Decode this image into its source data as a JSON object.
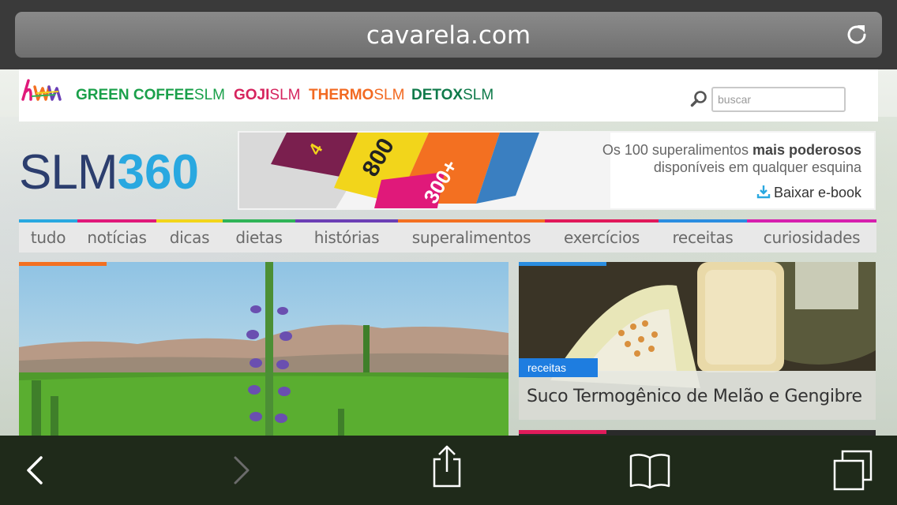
{
  "browser": {
    "url": "cavarela.com",
    "reload_icon": "reload-icon",
    "toolbar": {
      "back_icon": "chevron-left-icon",
      "forward_icon": "chevron-right-icon",
      "share_icon": "share-icon",
      "bookmarks_icon": "book-icon",
      "tabs_icon": "tabs-icon"
    }
  },
  "brandbar": {
    "logo_text": "hw",
    "brands": [
      {
        "bold": "GREEN COFFEE",
        "slm": "SLM",
        "color": "#1aa04a"
      },
      {
        "bold": "GOJI",
        "slm": "SLM",
        "color": "#d6245e"
      },
      {
        "bold": "THERMO",
        "slm": "SLM",
        "color": "#f26a22"
      },
      {
        "bold": "DETOX",
        "slm": "SLM",
        "color": "#0f7a4a"
      }
    ],
    "search_placeholder": "buscar"
  },
  "site": {
    "logo_slm": "SLM",
    "logo_num": "360"
  },
  "banner": {
    "line1_pre": "Os 100 superalimentos ",
    "line1_bold": "mais poderosos",
    "line2": "disponíveis em qualquer esquina",
    "link": "Baixar e-book",
    "art_numbers": [
      "4",
      "800",
      "300+"
    ]
  },
  "nav": {
    "items": [
      {
        "label": "tudo",
        "color": "#29a8e0"
      },
      {
        "label": "notícias",
        "color": "#e0197a"
      },
      {
        "label": "dicas",
        "color": "#f2d51b"
      },
      {
        "label": "dietas",
        "color": "#2fb457"
      },
      {
        "label": "histórias",
        "color": "#6b3fb5"
      },
      {
        "label": "superalimentos",
        "color": "#f37021"
      },
      {
        "label": "exercícios",
        "color": "#e0195a"
      },
      {
        "label": "receitas",
        "color": "#2a8de0"
      },
      {
        "label": "curiosidades",
        "color": "#d61fae"
      }
    ]
  },
  "features": {
    "right": {
      "category": "receitas",
      "title": "Suco Termogênico de Melão e Gengibre"
    }
  }
}
